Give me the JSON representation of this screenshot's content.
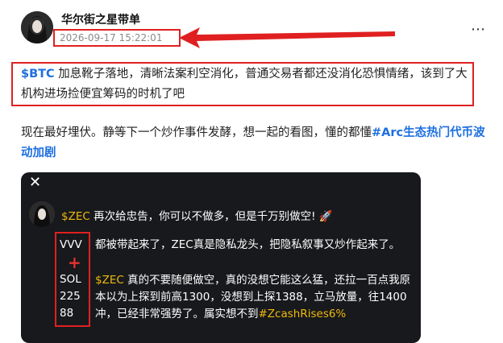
{
  "post": {
    "author": "华尔街之星带单",
    "timestamp": "2026-09-17 15:22:01",
    "more_icon": "more-horizontal-icon",
    "para1_ticker": "$BTC",
    "para1_text": " 加息靴子落地，清晰法案利空消化，普通交易者都还没消化恐惧情绪，该到了大机构进场捡便宜筹码的时机了吧",
    "para2_text": "现在最好埋伏。静等下一个炒作事件发酵，想一起的看图，懂的都懂",
    "para2_hashtag": "#Arc生态热门代币波动加剧"
  },
  "card": {
    "close_icon": "close-icon",
    "title_ticker": "$ZEC",
    "title_text": " 再次给忠告，你可以不做多，但是千万别做空!",
    "title_emoji": "🚀",
    "list": {
      "item1": "VVV",
      "plus": "+",
      "item2": "SOL",
      "item3": "225",
      "item4": "88"
    },
    "line1": "都被带起来了，ZEC真是隐私龙头，把隐私叙事又炒作起来了。",
    "line2_ticker": "$ZEC",
    "line2_text": " 真的不要随便做空，真的没想它能这么猛，还拉一百点我原本以为上探到前高1300，没想到上探1388，立马放量，往1400冲，已经非常强势了。属实想不到",
    "line2_hashtag": "#ZcashRises6%"
  },
  "colors": {
    "accent_blue": "#1d6fe0",
    "annotation_red": "#e02020",
    "card_bg": "#17191c",
    "ticker_gold": "#f0b90b"
  }
}
